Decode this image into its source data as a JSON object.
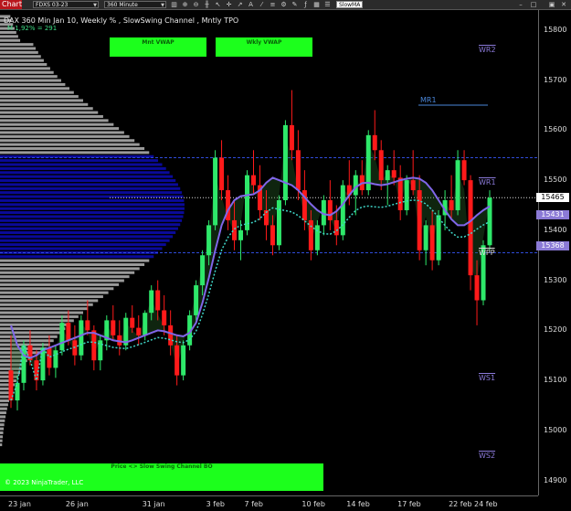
{
  "toolbar": {
    "chart_tab": "Chart",
    "instrument": "FDXS 03-23",
    "interval": "360 Minute",
    "search_value": "SlowMA"
  },
  "chart": {
    "title": "DAX 360 Min Jan 10, Weekly % , SlowSwing Channel , Mntly TPO",
    "subtitle": "M 1,92% = 291",
    "buttons": {
      "mnt_vwap": "Mnt VWAP",
      "wkly_vwap": "Wkly VWAP"
    },
    "bottom_label": "Price <> Slow Swing Channel BO",
    "copyright": "© 2023 NinjaTrader, LLC",
    "levels": [
      {
        "name": "WR2",
        "price": 15750,
        "color": "#8a79d8"
      },
      {
        "name": "MR1",
        "price": 15650,
        "color": "#4a86d8"
      },
      {
        "name": "WR1",
        "price": 15485,
        "color": "#8a79d8"
      },
      {
        "name": "WPP",
        "price": 15345,
        "color": "#e0e0e0"
      },
      {
        "name": "WS1",
        "price": 15095,
        "color": "#8a79d8"
      },
      {
        "name": "WS2",
        "price": 14940,
        "color": "#8a79d8"
      }
    ],
    "price_flags": [
      {
        "label": "15465",
        "price": 15465,
        "bg": "#ffffff",
        "fg": "#000000"
      },
      {
        "label": "15431",
        "price": 15431,
        "bg": "#8b7ad6",
        "fg": "#ffffff"
      },
      {
        "label": "15368",
        "price": 15368,
        "bg": "#8b7ad6",
        "fg": "#ffffff"
      }
    ]
  },
  "chart_data": {
    "type": "candlestick",
    "y_ticks": [
      15800,
      15700,
      15600,
      15500,
      15400,
      15300,
      15200,
      15100,
      15000,
      14900
    ],
    "ylim": [
      14870,
      15840
    ],
    "x_ticks": [
      "23 jan",
      "26 jan",
      "31 jan",
      "3 feb",
      "7 feb",
      "10 feb",
      "14 feb",
      "17 feb",
      "22 feb",
      "24 feb"
    ],
    "colors": {
      "up": "#2ee86a",
      "down": "#ff1a1a",
      "channel": "#8066e8",
      "vwap": "#3fd6c8",
      "profile": "#9a9a9a",
      "value_area": "#0a0a9a"
    },
    "candles": [
      [
        15120,
        15190,
        15045,
        15060
      ],
      [
        15060,
        15110,
        15040,
        15095
      ],
      [
        15095,
        15180,
        15080,
        15170
      ],
      [
        15170,
        15200,
        15130,
        15140
      ],
      [
        15140,
        15160,
        15080,
        15100
      ],
      [
        15100,
        15175,
        15090,
        15165
      ],
      [
        15165,
        15190,
        15110,
        15125
      ],
      [
        15125,
        15170,
        15105,
        15160
      ],
      [
        15160,
        15230,
        15150,
        15215
      ],
      [
        15215,
        15240,
        15170,
        15180
      ],
      [
        15180,
        15210,
        15130,
        15150
      ],
      [
        15150,
        15230,
        15140,
        15220
      ],
      [
        15220,
        15260,
        15190,
        15200
      ],
      [
        15200,
        15210,
        15120,
        15140
      ],
      [
        15140,
        15190,
        15120,
        15180
      ],
      [
        15180,
        15230,
        15160,
        15220
      ],
      [
        15220,
        15250,
        15180,
        15190
      ],
      [
        15190,
        15220,
        15150,
        15170
      ],
      [
        15170,
        15235,
        15160,
        15225
      ],
      [
        15225,
        15250,
        15195,
        15205
      ],
      [
        15205,
        15230,
        15170,
        15190
      ],
      [
        15190,
        15240,
        15180,
        15235
      ],
      [
        15235,
        15290,
        15220,
        15280
      ],
      [
        15280,
        15300,
        15220,
        15240
      ],
      [
        15240,
        15270,
        15190,
        15210
      ],
      [
        15210,
        15240,
        15150,
        15170
      ],
      [
        15170,
        15190,
        15090,
        15110
      ],
      [
        15110,
        15180,
        15100,
        15170
      ],
      [
        15170,
        15240,
        15160,
        15230
      ],
      [
        15230,
        15300,
        15220,
        15290
      ],
      [
        15290,
        15360,
        15270,
        15350
      ],
      [
        15350,
        15420,
        15330,
        15410
      ],
      [
        15410,
        15560,
        15400,
        15545
      ],
      [
        15545,
        15580,
        15460,
        15480
      ],
      [
        15480,
        15510,
        15400,
        15420
      ],
      [
        15420,
        15460,
        15360,
        15380
      ],
      [
        15380,
        15420,
        15340,
        15400
      ],
      [
        15400,
        15520,
        15390,
        15510
      ],
      [
        15510,
        15560,
        15470,
        15490
      ],
      [
        15490,
        15530,
        15420,
        15440
      ],
      [
        15440,
        15480,
        15380,
        15410
      ],
      [
        15410,
        15430,
        15350,
        15370
      ],
      [
        15370,
        15470,
        15360,
        15460
      ],
      [
        15460,
        15620,
        15450,
        15610
      ],
      [
        15610,
        15680,
        15540,
        15560
      ],
      [
        15560,
        15600,
        15460,
        15480
      ],
      [
        15480,
        15520,
        15400,
        15420
      ],
      [
        15420,
        15440,
        15340,
        15360
      ],
      [
        15360,
        15420,
        15350,
        15410
      ],
      [
        15410,
        15470,
        15390,
        15460
      ],
      [
        15460,
        15500,
        15400,
        15420
      ],
      [
        15420,
        15450,
        15370,
        15390
      ],
      [
        15390,
        15500,
        15380,
        15490
      ],
      [
        15490,
        15540,
        15450,
        15470
      ],
      [
        15470,
        15520,
        15430,
        15510
      ],
      [
        15510,
        15540,
        15470,
        15480
      ],
      [
        15480,
        15600,
        15470,
        15590
      ],
      [
        15590,
        15640,
        15540,
        15560
      ],
      [
        15560,
        15580,
        15480,
        15500
      ],
      [
        15500,
        15530,
        15450,
        15520
      ],
      [
        15520,
        15560,
        15490,
        15505
      ],
      [
        15505,
        15530,
        15420,
        15440
      ],
      [
        15440,
        15510,
        15430,
        15500
      ],
      [
        15500,
        15560,
        15470,
        15480
      ],
      [
        15480,
        15510,
        15340,
        15360
      ],
      [
        15360,
        15420,
        15330,
        15410
      ],
      [
        15410,
        15440,
        15320,
        15340
      ],
      [
        15340,
        15440,
        15330,
        15430
      ],
      [
        15430,
        15480,
        15400,
        15460
      ],
      [
        15460,
        15510,
        15420,
        15440
      ],
      [
        15440,
        15560,
        15430,
        15540
      ],
      [
        15540,
        15560,
        15490,
        15500
      ],
      [
        15500,
        15510,
        15280,
        15310
      ],
      [
        15310,
        15340,
        15210,
        15260
      ],
      [
        15260,
        15380,
        15250,
        15370
      ],
      [
        15370,
        15480,
        15360,
        15465
      ]
    ],
    "channel": [
      15210,
      15170,
      15150,
      15145,
      15150,
      15160,
      15165,
      15170,
      15175,
      15180,
      15185,
      15190,
      15195,
      15195,
      15190,
      15185,
      15180,
      15178,
      15176,
      15180,
      15185,
      15190,
      15195,
      15200,
      15198,
      15194,
      15190,
      15188,
      15195,
      15215,
      15255,
      15305,
      15360,
      15410,
      15440,
      15460,
      15468,
      15470,
      15472,
      15480,
      15495,
      15505,
      15500,
      15495,
      15490,
      15480,
      15466,
      15452,
      15440,
      15432,
      15430,
      15438,
      15452,
      15470,
      15486,
      15494,
      15495,
      15492,
      15490,
      15492,
      15496,
      15500,
      15503,
      15505,
      15503,
      15495,
      15480,
      15460,
      15440,
      15422,
      15410,
      15410,
      15418,
      15430,
      15440,
      15448
    ]
  }
}
